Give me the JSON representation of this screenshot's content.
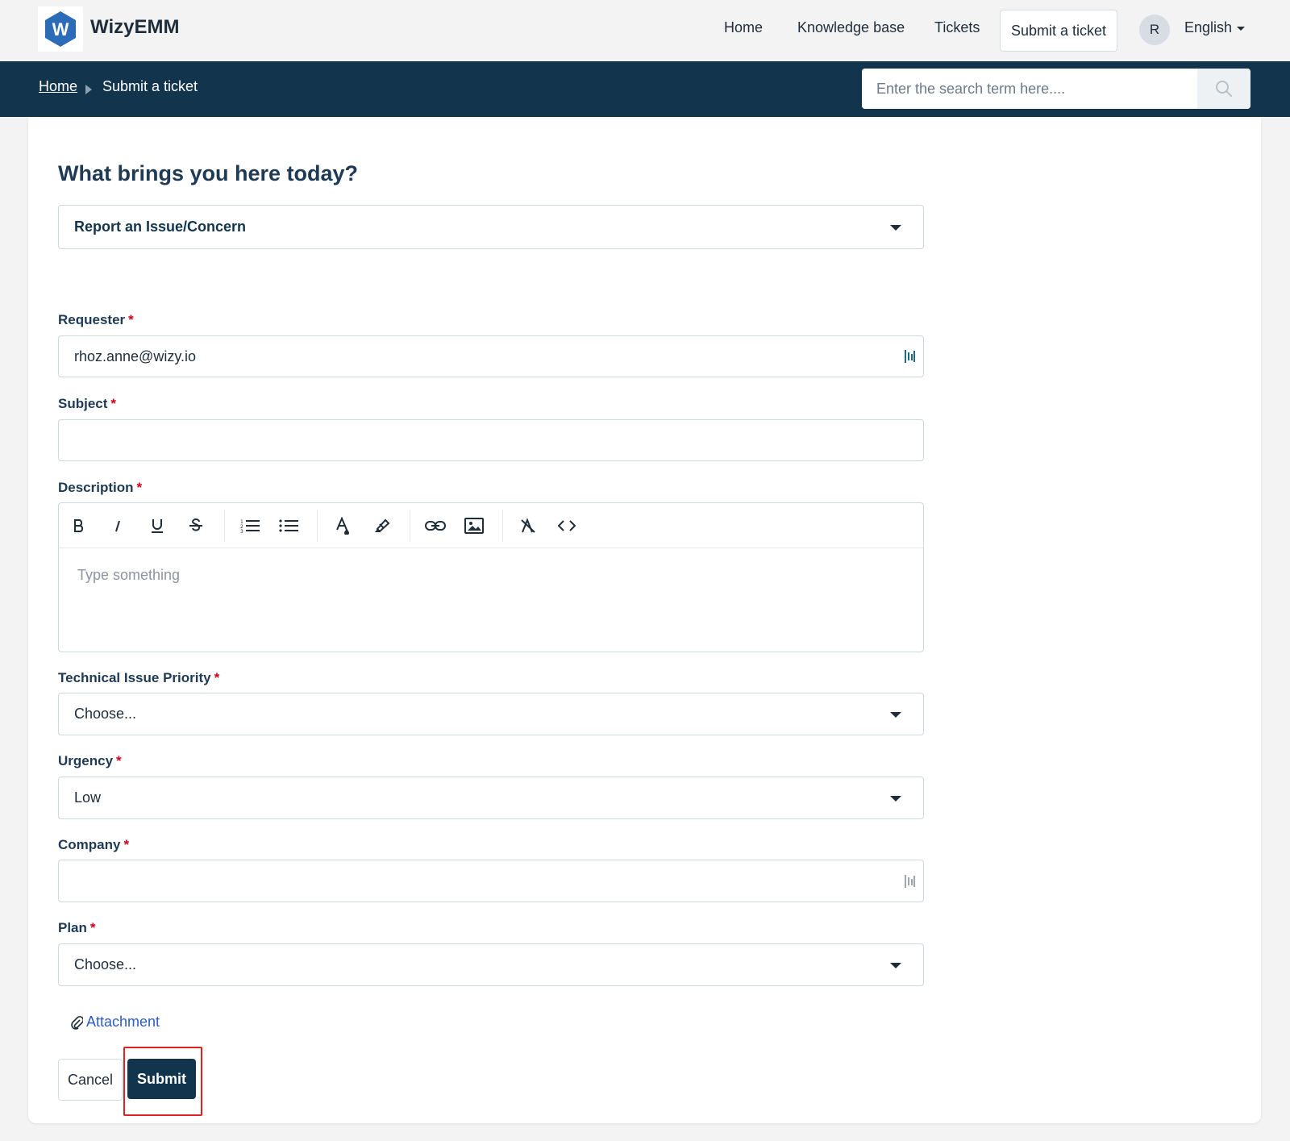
{
  "header": {
    "brand": "WizyEMM",
    "logo_letter": "W",
    "nav": {
      "home": "Home",
      "knowledge_base": "Knowledge base",
      "tickets": "Tickets",
      "submit_ticket": "Submit a ticket"
    },
    "avatar_initial": "R",
    "language": "English"
  },
  "breadcrumb": {
    "home": "Home",
    "current": "Submit a ticket"
  },
  "search": {
    "placeholder": "Enter the search term here...."
  },
  "form": {
    "heading": "What brings you here today?",
    "ticket_type": "Report an Issue/Concern",
    "required_marker": "*",
    "requester": {
      "label": "Requester",
      "value": "rhoz.anne@wizy.io"
    },
    "subject": {
      "label": "Subject",
      "value": ""
    },
    "description": {
      "label": "Description",
      "placeholder": "Type something"
    },
    "priority": {
      "label": "Technical Issue Priority",
      "value": "Choose..."
    },
    "urgency": {
      "label": "Urgency",
      "value": "Low"
    },
    "company": {
      "label": "Company",
      "value": ""
    },
    "plan": {
      "label": "Plan",
      "value": "Choose..."
    },
    "attachment_label": "Attachment",
    "cancel_label": "Cancel",
    "submit_label": "Submit"
  },
  "editor_toolbar": [
    "bold-icon",
    "italic-icon",
    "underline-icon",
    "strikethrough-icon",
    "ordered-list-icon",
    "bullet-list-icon",
    "text-color-icon",
    "highlight-icon",
    "link-icon",
    "image-icon",
    "clear-format-icon",
    "code-icon"
  ],
  "colors": {
    "primary": "#12344d",
    "required": "#d0021b",
    "link": "#2c5cc5",
    "highlight_box": "#e02020",
    "logo": "#2c6bb8"
  }
}
